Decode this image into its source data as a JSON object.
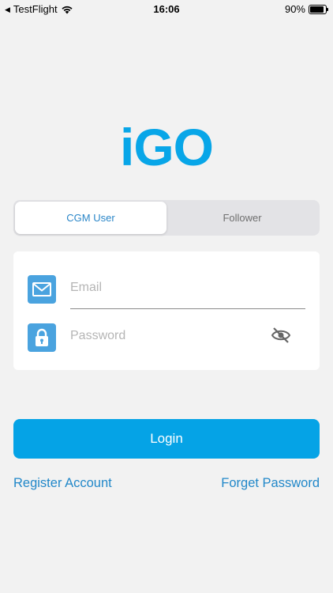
{
  "status_bar": {
    "back_app": "TestFlight",
    "time": "16:06",
    "battery": "90%",
    "battery_level": 0.9,
    "back_icon": "back-arrow-icon",
    "wifi_icon": "wifi-icon",
    "battery_icon": "battery-icon"
  },
  "logo": {
    "text": "iGO",
    "color": "#08a6e8"
  },
  "segmented": {
    "options": [
      {
        "label": "CGM User",
        "selected": true
      },
      {
        "label": "Follower",
        "selected": false
      }
    ]
  },
  "form": {
    "email": {
      "placeholder": "Email",
      "value": "",
      "icon": "envelope-icon"
    },
    "password": {
      "placeholder": "Password",
      "value": "",
      "icon": "lock-icon",
      "toggle_icon": "eye-slash-icon"
    }
  },
  "actions": {
    "login_label": "Login",
    "register_label": "Register Account",
    "forget_label": "Forget Password"
  },
  "colors": {
    "accent": "#05a3e6",
    "link": "#2288c9",
    "icon_bg": "#4aa3df",
    "background": "#f2f2f2"
  }
}
